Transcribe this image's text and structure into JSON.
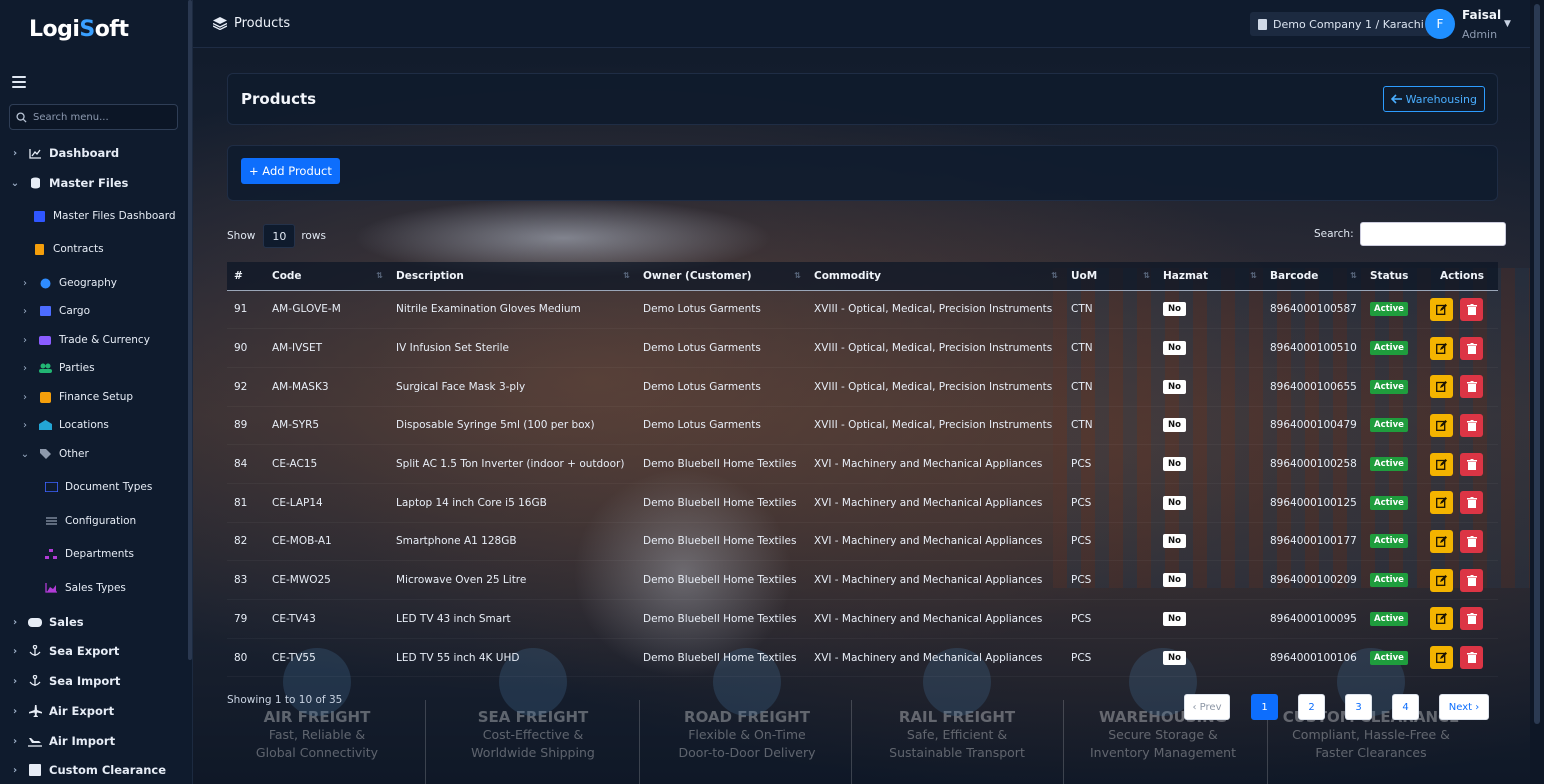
{
  "app": {
    "logo_part1": "Logi",
    "logo_o": "S",
    "logo_part2": "oft",
    "search_placeholder": "Search menu...",
    "accent_color": "#0d6efd"
  },
  "sidebar": {
    "items": [
      {
        "label": "Dashboard",
        "icon": "chart-line-icon",
        "chevron": "›"
      },
      {
        "label": "Master Files",
        "icon": "database-icon",
        "chevron": "⌄"
      },
      {
        "label": "Master Files Dashboard",
        "icon": "grid-icon"
      },
      {
        "label": "Contracts",
        "icon": "file-icon"
      },
      {
        "label": "Geography",
        "icon": "globe-icon",
        "chevron": "›"
      },
      {
        "label": "Cargo",
        "icon": "box-icon",
        "chevron": "›"
      },
      {
        "label": "Trade & Currency",
        "icon": "exchange-icon",
        "chevron": "›"
      },
      {
        "label": "Parties",
        "icon": "users-icon",
        "chevron": "›"
      },
      {
        "label": "Finance Setup",
        "icon": "coins-icon",
        "chevron": "›"
      },
      {
        "label": "Locations",
        "icon": "warehouse-icon",
        "chevron": "›"
      },
      {
        "label": "Other",
        "icon": "tags-icon",
        "chevron": "⌄"
      },
      {
        "label": "Document Types",
        "icon": "id-card-icon"
      },
      {
        "label": "Configuration",
        "icon": "sliders-icon"
      },
      {
        "label": "Departments",
        "icon": "sitemap-icon"
      },
      {
        "label": "Sales Types",
        "icon": "chart-area-icon"
      },
      {
        "label": "Sales",
        "icon": "handshake-icon",
        "chevron": "›"
      },
      {
        "label": "Sea Export",
        "icon": "anchor-icon",
        "chevron": "›"
      },
      {
        "label": "Sea Import",
        "icon": "anchor-icon",
        "chevron": "›"
      },
      {
        "label": "Air Export",
        "icon": "plane-icon",
        "chevron": "›"
      },
      {
        "label": "Air Import",
        "icon": "plane-landing-icon",
        "chevron": "›"
      },
      {
        "label": "Custom Clearance",
        "icon": "building-icon",
        "chevron": "›"
      }
    ]
  },
  "header": {
    "title": "Products",
    "company": "Demo Company 1 / Karachi",
    "avatar_initial": "F",
    "user_name": "Faisal",
    "user_role": "Admin"
  },
  "page": {
    "title": "Products",
    "back_label": "Warehousing",
    "add_label": "+ Add Product",
    "show_label": "Show",
    "rows_value": "10",
    "rows_label": "rows",
    "search_label": "Search:"
  },
  "table": {
    "columns": [
      "#",
      "Code",
      "Description",
      "Owner (Customer)",
      "Commodity",
      "UoM",
      "Hazmat",
      "Barcode",
      "Status",
      "Actions"
    ],
    "rows": [
      {
        "no": "91",
        "code": "AM-GLOVE-M",
        "desc": "Nitrile Examination Gloves Medium",
        "owner": "Demo Lotus Garments",
        "commodity": "XVIII - Optical, Medical, Precision Instruments",
        "uom": "CTN",
        "hazmat": "No",
        "barcode": "8964000100587",
        "status": "Active"
      },
      {
        "no": "90",
        "code": "AM-IVSET",
        "desc": "IV Infusion Set Sterile",
        "owner": "Demo Lotus Garments",
        "commodity": "XVIII - Optical, Medical, Precision Instruments",
        "uom": "CTN",
        "hazmat": "No",
        "barcode": "8964000100510",
        "status": "Active"
      },
      {
        "no": "92",
        "code": "AM-MASK3",
        "desc": "Surgical Face Mask 3-ply",
        "owner": "Demo Lotus Garments",
        "commodity": "XVIII - Optical, Medical, Precision Instruments",
        "uom": "CTN",
        "hazmat": "No",
        "barcode": "8964000100655",
        "status": "Active"
      },
      {
        "no": "89",
        "code": "AM-SYR5",
        "desc": "Disposable Syringe 5ml (100 per box)",
        "owner": "Demo Lotus Garments",
        "commodity": "XVIII - Optical, Medical, Precision Instruments",
        "uom": "CTN",
        "hazmat": "No",
        "barcode": "8964000100479",
        "status": "Active"
      },
      {
        "no": "84",
        "code": "CE-AC15",
        "desc": "Split AC 1.5 Ton Inverter (indoor + outdoor)",
        "owner": "Demo Bluebell Home Textiles",
        "commodity": "XVI - Machinery and Mechanical Appliances",
        "uom": "PCS",
        "hazmat": "No",
        "barcode": "8964000100258",
        "status": "Active"
      },
      {
        "no": "81",
        "code": "CE-LAP14",
        "desc": "Laptop 14 inch Core i5 16GB",
        "owner": "Demo Bluebell Home Textiles",
        "commodity": "XVI - Machinery and Mechanical Appliances",
        "uom": "PCS",
        "hazmat": "No",
        "barcode": "8964000100125",
        "status": "Active"
      },
      {
        "no": "82",
        "code": "CE-MOB-A1",
        "desc": "Smartphone A1 128GB",
        "owner": "Demo Bluebell Home Textiles",
        "commodity": "XVI - Machinery and Mechanical Appliances",
        "uom": "PCS",
        "hazmat": "No",
        "barcode": "8964000100177",
        "status": "Active"
      },
      {
        "no": "83",
        "code": "CE-MWO25",
        "desc": "Microwave Oven 25 Litre",
        "owner": "Demo Bluebell Home Textiles",
        "commodity": "XVI - Machinery and Mechanical Appliances",
        "uom": "PCS",
        "hazmat": "No",
        "barcode": "8964000100209",
        "status": "Active"
      },
      {
        "no": "79",
        "code": "CE-TV43",
        "desc": "LED TV 43 inch Smart",
        "owner": "Demo Bluebell Home Textiles",
        "commodity": "XVI - Machinery and Mechanical Appliances",
        "uom": "PCS",
        "hazmat": "No",
        "barcode": "8964000100095",
        "status": "Active"
      },
      {
        "no": "80",
        "code": "CE-TV55",
        "desc": "LED TV 55 inch 4K UHD",
        "owner": "Demo Bluebell Home Textiles",
        "commodity": "XVI - Machinery and Mechanical Appliances",
        "uom": "PCS",
        "hazmat": "No",
        "barcode": "8964000100106",
        "status": "Active"
      }
    ]
  },
  "footer": {
    "info": "Showing 1 to 10 of 35",
    "prev": "‹ Prev",
    "next": "Next ›",
    "pages": [
      "1",
      "2",
      "3",
      "4"
    ],
    "current_page": "1"
  },
  "services": [
    {
      "title": "AIR FREIGHT",
      "sub1": "Fast, Reliable &",
      "sub2": "Global Connectivity"
    },
    {
      "title": "SEA FREIGHT",
      "sub1": "Cost-Effective &",
      "sub2": "Worldwide Shipping"
    },
    {
      "title": "ROAD FREIGHT",
      "sub1": "Flexible & On-Time",
      "sub2": "Door-to-Door Delivery"
    },
    {
      "title": "RAIL FREIGHT",
      "sub1": "Safe, Efficient &",
      "sub2": "Sustainable Transport"
    },
    {
      "title": "WAREHOUSING",
      "sub1": "Secure Storage &",
      "sub2": "Inventory Management"
    },
    {
      "title": "CUSTOM CLEARANCE",
      "sub1": "Compliant, Hassle-Free &",
      "sub2": "Faster Clearances"
    }
  ]
}
